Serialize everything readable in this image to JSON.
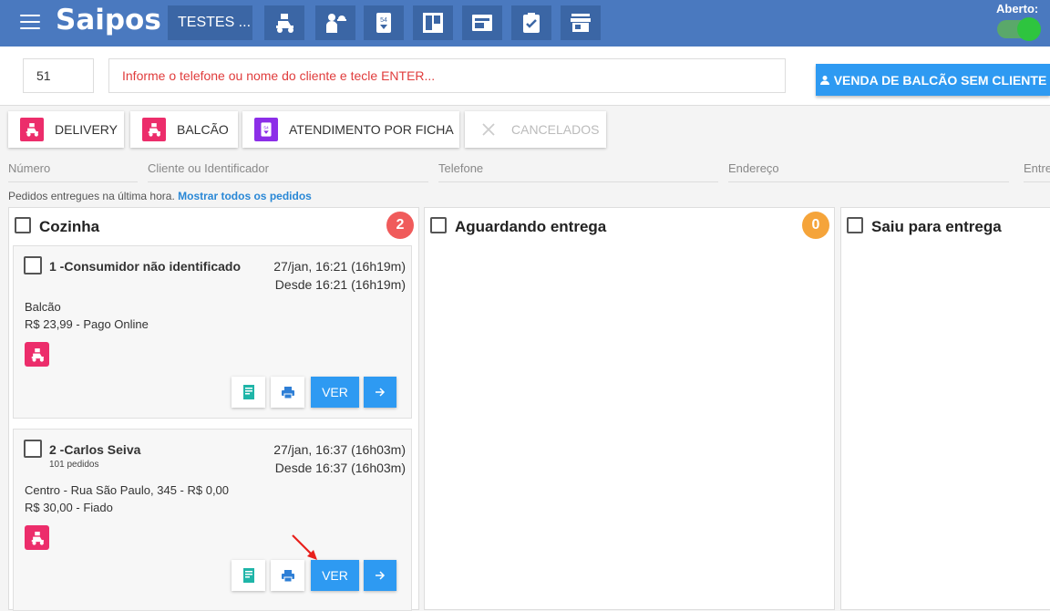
{
  "app": {
    "logo": "Saipos",
    "store_name": "TESTES ...",
    "status_label": "Aberto:"
  },
  "toolbar_icons": [
    "delivery-icon",
    "waiter-icon",
    "ticket-icon",
    "kanban-icon",
    "display-icon",
    "checklist-icon",
    "store-icon"
  ],
  "search": {
    "order_number": "51",
    "client_placeholder": "Informe o telefone ou nome do cliente e tecle ENTER...",
    "walkin_button": "VENDA DE BALCÃO SEM CLIENTE"
  },
  "filters": {
    "delivery": "DELIVERY",
    "balcao": "BALCÃO",
    "ficha": "ATENDIMENTO POR FICHA",
    "cancelados": "CANCELADOS"
  },
  "columns_filter": {
    "numero": "Número",
    "cliente": "Cliente ou Identificador",
    "telefone": "Telefone",
    "endereco": "Endereço",
    "entregador": "Entre"
  },
  "info": {
    "text": "Pedidos entregues na última hora.",
    "link": "Mostrar todos os pedidos"
  },
  "kanban": [
    {
      "title": "Cozinha",
      "count": "2",
      "color": "#f05b5b"
    },
    {
      "title": "Aguardando entrega",
      "count": "0",
      "color": "#f5a43a"
    },
    {
      "title": "Saiu para entrega",
      "count": "",
      "color": ""
    }
  ],
  "orders": [
    {
      "name": "1 -Consumidor não identificado",
      "sub": "",
      "date": "27/jan, 16:21 (16h19m)",
      "since": "Desde 16:21 (16h19m)",
      "line1": "Balcão",
      "line2": "R$ 23,99 - Pago Online",
      "view": "VER"
    },
    {
      "name": "2 -Carlos Seiva",
      "sub": "101 pedidos",
      "date": "27/jan, 16:37 (16h03m)",
      "since": "Desde 16:37 (16h03m)",
      "line1": "Centro - Rua São Paulo, 345 - R$ 0,00",
      "line2": "R$ 30,00 - Fiado",
      "view": "VER"
    }
  ]
}
